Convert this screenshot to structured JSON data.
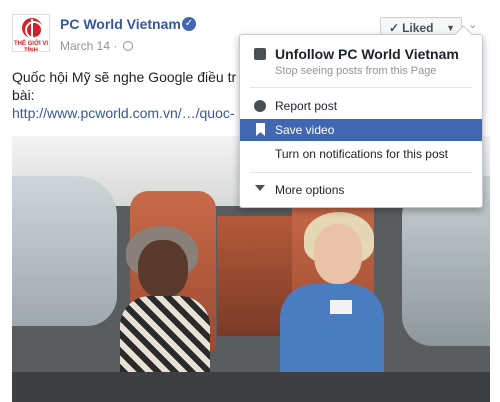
{
  "post": {
    "page_name": "PC World Vietnam",
    "date": "March 14",
    "date_separator": "·",
    "logo_text": "THẾ GIỚI VI TÍNH",
    "liked_label": "Liked",
    "text_line1": "Quốc hội Mỹ sẽ nghe Google điều tr",
    "text_line2": "bài:",
    "link": "http://www.pcworld.com.vn/…/quoc-"
  },
  "menu": {
    "unfollow_title": "Unfollow PC World Vietnam",
    "unfollow_sub": "Stop seeing posts from this Page",
    "report": "Report post",
    "save": "Save video",
    "notifications": "Turn on notifications for this post",
    "more": "More options"
  },
  "colors": {
    "link": "#365899",
    "highlight": "#4267b2",
    "verified": "#4267b2",
    "logo_red": "#d4202a"
  }
}
